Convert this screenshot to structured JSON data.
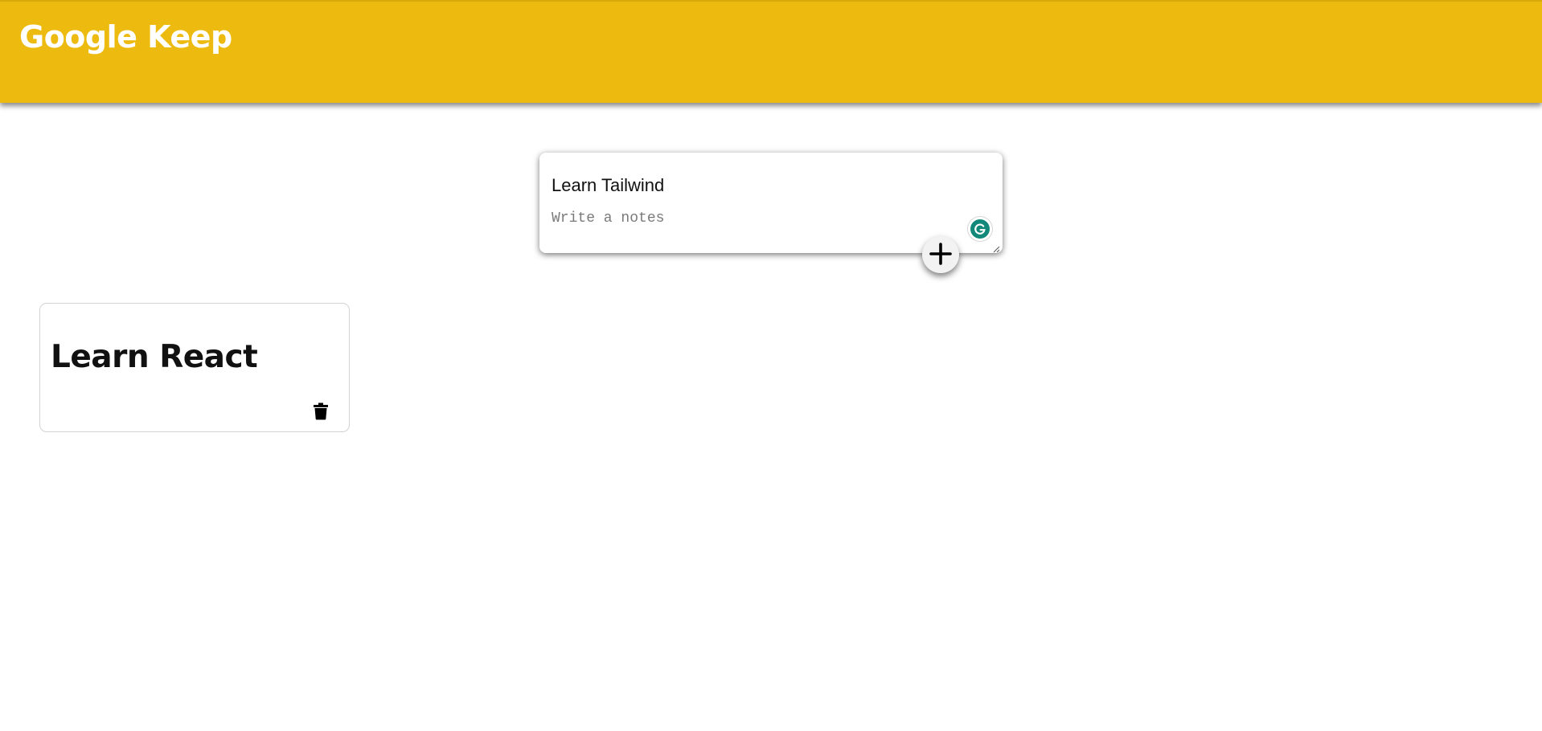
{
  "header": {
    "app_title": "Google Keep",
    "background_color": "#edbb10"
  },
  "create_note": {
    "title_value": "Learn Tailwind",
    "content_value": "",
    "content_placeholder": "Write a notes",
    "grammarly_icon": "grammarly-icon",
    "add_icon": "plus-icon"
  },
  "notes": [
    {
      "title": "Learn React",
      "delete_icon": "trash-icon"
    }
  ]
}
